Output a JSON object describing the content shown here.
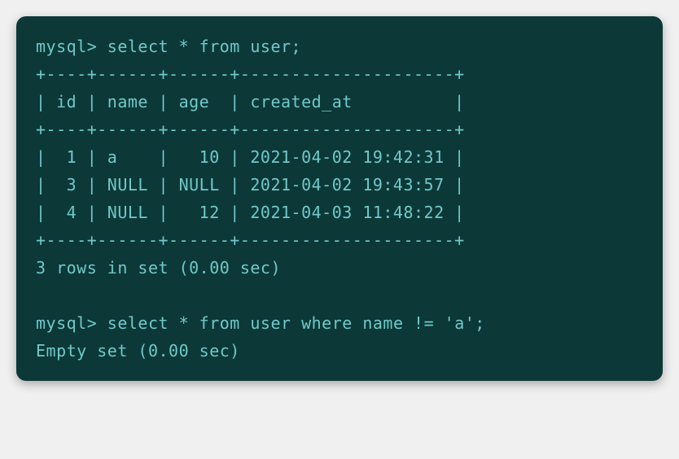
{
  "prompt": "mysql>",
  "query1": "select * from user;",
  "table": {
    "border_top": "+----+------+------+---------------------+",
    "header": "| id | name | age  | created_at          |",
    "border_mid": "+----+------+------+---------------------+",
    "rows": [
      "|  1 | a    |   10 | 2021-04-02 19:42:31 |",
      "|  3 | NULL | NULL | 2021-04-02 19:43:57 |",
      "|  4 | NULL |   12 | 2021-04-03 11:48:22 |"
    ],
    "border_bottom": "+----+------+------+---------------------+"
  },
  "result1": "3 rows in set (0.00 sec)",
  "query2": "select * from user where name != 'a';",
  "result2": "Empty set (0.00 sec)"
}
